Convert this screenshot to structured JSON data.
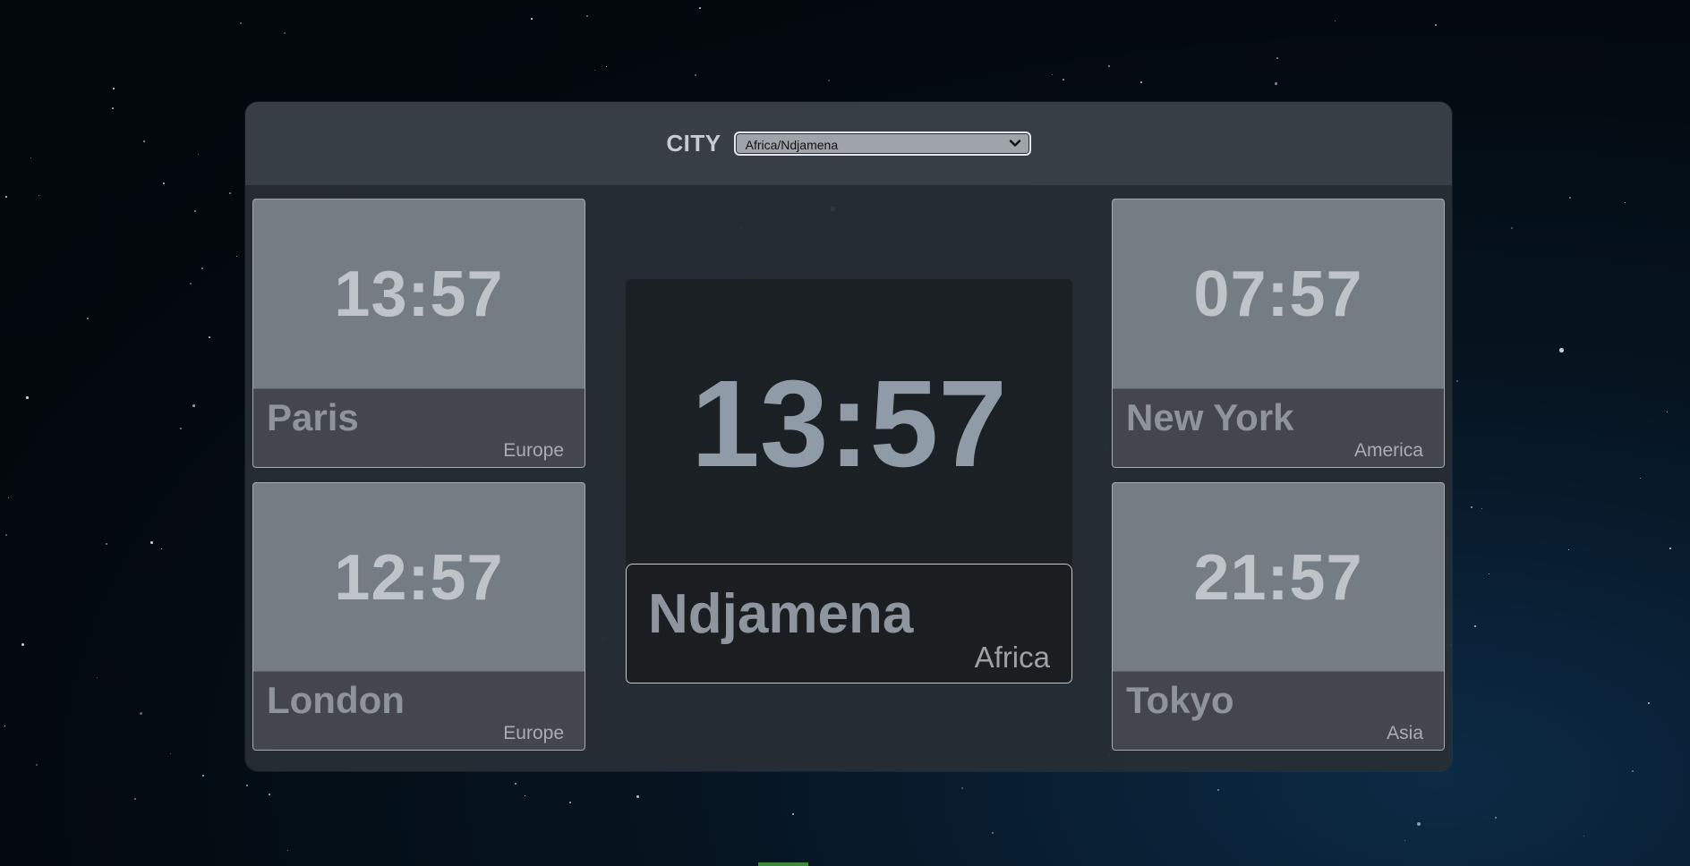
{
  "selector": {
    "label": "CITY",
    "selected": "Africa/Ndjamena",
    "icon": "chevron-down-icon"
  },
  "main_clock": {
    "time": "13:57",
    "city": "Ndjamena",
    "region": "Africa"
  },
  "clocks": [
    {
      "time": "13:57",
      "city": "Paris",
      "region": "Europe"
    },
    {
      "time": "12:57",
      "city": "London",
      "region": "Europe"
    },
    {
      "time": "07:57",
      "city": "New York",
      "region": "America"
    },
    {
      "time": "21:57",
      "city": "Tokyo",
      "region": "Asia"
    }
  ],
  "colors": {
    "background": "#03090e",
    "panel": "#282e35",
    "card": "#80888f",
    "accent_text": "#8f9ca8"
  }
}
